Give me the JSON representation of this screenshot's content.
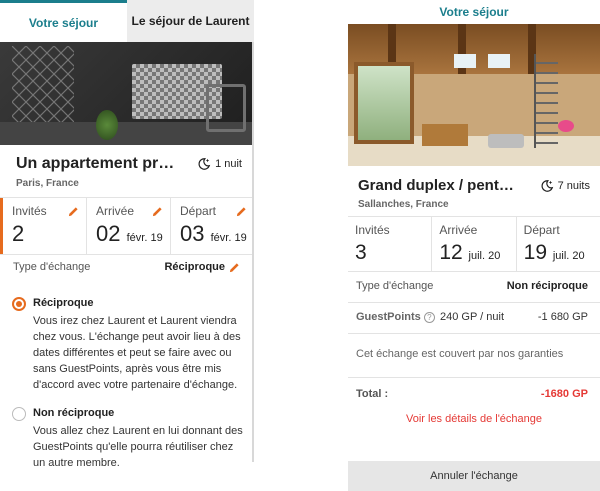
{
  "left": {
    "tabs": {
      "active": "Votre séjour",
      "inactive": "Le séjour de Laurent"
    },
    "property": {
      "title": "Un appartement proch...",
      "location": "Paris, France",
      "nights": "1 nuit"
    },
    "stats": {
      "guests": {
        "label": "Invités",
        "value": "2"
      },
      "arrival": {
        "label": "Arrivée",
        "day": "02",
        "month_year": "févr. 19"
      },
      "departure": {
        "label": "Départ",
        "day": "03",
        "month_year": "févr. 19"
      }
    },
    "exchange_type": {
      "label": "Type d'échange",
      "value": "Réciproque"
    },
    "options": [
      {
        "title": "Réciproque",
        "selected": true,
        "description": "Vous irez chez Laurent et Laurent viendra chez vous. L'échange peut avoir lieu à des dates différentes et peut se faire avec ou sans GuestPoints, après vous être mis d'accord avec votre partenaire d'échange."
      },
      {
        "title": "Non réciproque",
        "selected": false,
        "description": "Vous allez chez Laurent en lui donnant des GuestPoints qu'elle pourra réutiliser chez un autre membre."
      }
    ]
  },
  "right": {
    "tab": "Votre séjour",
    "property": {
      "title": "Grand duplex / penth...",
      "location": "Sallanches, France",
      "nights": "7 nuits"
    },
    "stats": {
      "guests": {
        "label": "Invités",
        "value": "3"
      },
      "arrival": {
        "label": "Arrivée",
        "day": "12",
        "month_year": "juil. 20"
      },
      "departure": {
        "label": "Départ",
        "day": "19",
        "month_year": "juil. 20"
      }
    },
    "exchange_type": {
      "label": "Type d'échange",
      "value": "Non réciproque"
    },
    "guestpoints": {
      "label": "GuestPoints",
      "help": "?",
      "rate": "240 GP / nuit",
      "amount": "-1 680 GP"
    },
    "guarantee": "Cet échange est couvert par nos garanties",
    "total": {
      "label": "Total :",
      "value": "-1680 GP"
    },
    "details_link": "Voir les détails de l'échange",
    "cancel_button": "Annuler l'échange"
  },
  "colors": {
    "teal": "#1b7e8c",
    "orange": "#e66b1e",
    "red": "#e53935"
  },
  "icons": {
    "nights": "moon-star-icon",
    "edit": "pencil-icon",
    "help": "question-circle-icon"
  }
}
